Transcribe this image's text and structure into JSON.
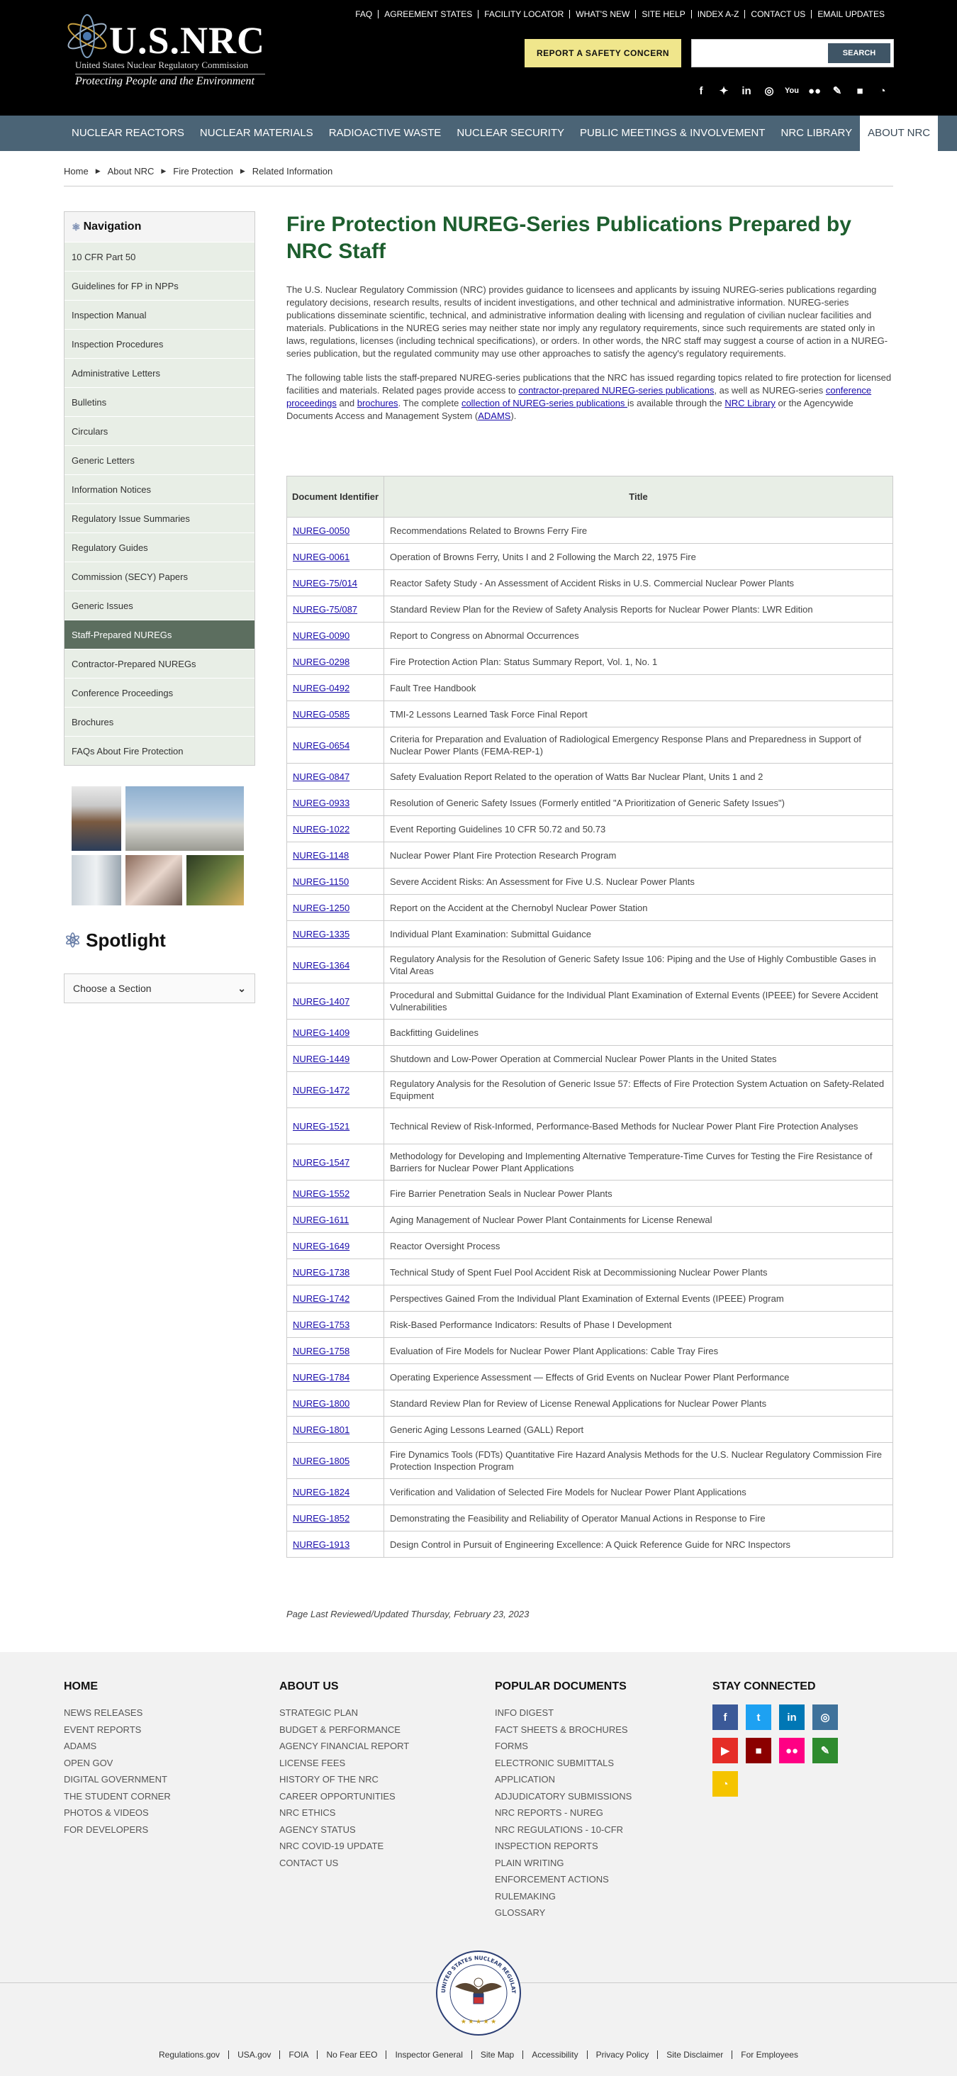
{
  "header": {
    "logo_title": "U.S.NRC",
    "logo_subtitle": "United States Nuclear Regulatory Commission",
    "logo_tagline": "Protecting People and the Environment",
    "top_links": [
      "FAQ",
      "AGREEMENT STATES",
      "FACILITY LOCATOR",
      "WHAT'S NEW",
      "SITE HELP",
      "INDEX A-Z",
      "CONTACT US",
      "EMAIL UPDATES"
    ],
    "report_button": "REPORT A SAFETY CONCERN",
    "search_button": "SEARCH",
    "search_value": "",
    "social_icons": [
      "facebook-icon",
      "twitter-icon",
      "linkedin-icon",
      "instagram-icon",
      "youtube-icon",
      "flickr-icon",
      "blog-icon",
      "chat-icon",
      "rss-icon"
    ]
  },
  "nav": [
    "NUCLEAR REACTORS",
    "NUCLEAR MATERIALS",
    "RADIOACTIVE WASTE",
    "NUCLEAR SECURITY",
    "PUBLIC MEETINGS & INVOLVEMENT",
    "NRC LIBRARY",
    "ABOUT NRC"
  ],
  "breadcrumb": [
    "Home",
    "About NRC",
    "Fire Protection",
    "Related Information"
  ],
  "sidenav": {
    "title": "Navigation",
    "items": [
      "10 CFR Part 50",
      "Guidelines for FP in NPPs",
      "Inspection Manual",
      "Inspection Procedures",
      "Administrative Letters",
      "Bulletins",
      "Circulars",
      "Generic Letters",
      "Information Notices",
      "Regulatory Issue Summaries",
      "Regulatory Guides",
      "Commission (SECY) Papers",
      "Generic Issues",
      "Staff-Prepared NUREGs",
      "Contractor-Prepared NUREGs",
      "Conference Proceedings",
      "Brochures",
      "FAQs About Fire Protection"
    ],
    "active": "Staff-Prepared NUREGs"
  },
  "spotlight": {
    "title": "Spotlight",
    "select": "Choose a Section"
  },
  "main": {
    "title": "Fire Protection NUREG-Series Publications Prepared by NRC Staff",
    "intro": "The U.S. Nuclear Regulatory Commission (NRC) provides guidance to licensees and applicants by issuing NUREG-series publications regarding regulatory decisions, research results, results of incident investigations, and other technical and administrative information. NUREG-series publications disseminate scientific, technical, and administrative information dealing with licensing and regulation of civilian nuclear facilities and materials. Publications in the NUREG series may neither state nor imply any regulatory requirements, since such requirements are stated only in laws, regulations, licenses (including technical specifications), or orders. In other words, the NRC staff may suggest a course of action in a NUREG-series publication, but the regulated community may use other approaches to satisfy the agency's regulatory requirements.",
    "p2_a": "The following table lists the staff-prepared NUREG-series publications that the NRC has issued regarding topics related to fire protection for licensed facilities and materials. Related pages provide access to ",
    "p2_link1": "contractor-prepared NUREG-series publications",
    "p2_b": ", as well as NUREG-series ",
    "p2_link2": "conference proceedings",
    "p2_c": " and ",
    "p2_link3": "brochures",
    "p2_d": ". The complete ",
    "p2_link4": "collection of NUREG-series publications ",
    "p2_e": "is available through the ",
    "p2_link5": "NRC Library",
    "p2_f": " or the Agencywide Documents Access and Management System (",
    "p2_link6": "ADAMS",
    "p2_g": ").",
    "table_headers": [
      "Document Identifier",
      "Title"
    ],
    "rows": [
      {
        "id": "NUREG-0050",
        "title": "Recommendations Related to Browns Ferry Fire"
      },
      {
        "id": "NUREG-0061",
        "title": "Operation of Browns Ferry, Units I and 2 Following the March 22, 1975 Fire"
      },
      {
        "id": "NUREG-75/014",
        "title": "Reactor Safety Study - An Assessment of Accident Risks in U.S. Commercial Nuclear Power Plants"
      },
      {
        "id": "NUREG-75/087",
        "title": "Standard Review Plan for the Review of Safety Analysis Reports for Nuclear Power Plants: LWR Edition"
      },
      {
        "id": "NUREG-0090",
        "title": "Report to Congress on Abnormal Occurrences"
      },
      {
        "id": "NUREG-0298",
        "title": "Fire Protection Action Plan: Status Summary Report, Vol. 1, No. 1"
      },
      {
        "id": "NUREG-0492",
        "title": "Fault Tree Handbook"
      },
      {
        "id": "NUREG-0585",
        "title": "TMI-2 Lessons Learned Task Force Final Report"
      },
      {
        "id": "NUREG-0654",
        "title": "Criteria for Preparation and Evaluation of Radiological Emergency Response Plans and Preparedness in Support of Nuclear Power Plants (FEMA-REP-1)"
      },
      {
        "id": "NUREG-0847",
        "title": "Safety Evaluation Report Related to the operation of Watts Bar Nuclear Plant, Units 1 and 2"
      },
      {
        "id": "NUREG-0933",
        "title": "Resolution of Generic Safety Issues (Formerly entitled \"A Prioritization of Generic Safety Issues\")"
      },
      {
        "id": "NUREG-1022",
        "title": "Event Reporting Guidelines 10 CFR 50.72 and 50.73"
      },
      {
        "id": "NUREG-1148",
        "title": "Nuclear Power Plant Fire Protection Research Program"
      },
      {
        "id": "NUREG-1150",
        "title": "Severe Accident Risks: An Assessment for Five U.S. Nuclear Power Plants"
      },
      {
        "id": "NUREG-1250",
        "title": "Report on the Accident at the Chernobyl Nuclear Power Station"
      },
      {
        "id": "NUREG-1335",
        "title": "Individual Plant Examination: Submittal Guidance"
      },
      {
        "id": "NUREG-1364",
        "title": "Regulatory Analysis for the Resolution of Generic Safety Issue 106: Piping and the Use of Highly Combustible Gases in Vital Areas"
      },
      {
        "id": "NUREG-1407",
        "title": "Procedural and Submittal Guidance for the Individual Plant Examination of External Events (IPEEE) for Severe Accident Vulnerabilities"
      },
      {
        "id": "NUREG-1409",
        "title": "Backfitting Guidelines"
      },
      {
        "id": "NUREG-1449",
        "title": "Shutdown and Low-Power Operation at Commercial Nuclear Power Plants in the United States"
      },
      {
        "id": "NUREG-1472",
        "title": "Regulatory Analysis for the Resolution of Generic Issue 57: Effects of Fire Protection System Actuation on Safety-Related Equipment"
      },
      {
        "id": "NUREG-1521",
        "title": "Technical Review of Risk-Informed, Performance-Based Methods for Nuclear Power Plant Fire Protection Analyses"
      },
      {
        "id": "NUREG-1547",
        "title": "Methodology for Developing and Implementing Alternative Temperature-Time Curves for Testing the Fire Resistance of Barriers for Nuclear Power Plant Applications"
      },
      {
        "id": "NUREG-1552",
        "title": "Fire Barrier Penetration Seals in Nuclear Power Plants"
      },
      {
        "id": "NUREG-1611",
        "title": "Aging Management of Nuclear Power Plant Containments for License Renewal"
      },
      {
        "id": "NUREG-1649",
        "title": "Reactor Oversight Process"
      },
      {
        "id": "NUREG-1738",
        "title": "Technical Study of Spent Fuel Pool Accident Risk at Decommissioning Nuclear Power Plants"
      },
      {
        "id": "NUREG-1742",
        "title": "Perspectives Gained From the Individual Plant Examination of External Events (IPEEE) Program"
      },
      {
        "id": "NUREG-1753",
        "title": "Risk-Based Performance Indicators: Results of Phase I Development"
      },
      {
        "id": "NUREG-1758",
        "title": "Evaluation of Fire Models for Nuclear Power Plant Applications: Cable Tray Fires"
      },
      {
        "id": "NUREG-1784",
        "title": "Operating Experience Assessment — Effects of Grid Events on Nuclear Power Plant Performance"
      },
      {
        "id": "NUREG-1800",
        "title": "Standard Review Plan for Review of License Renewal Applications for Nuclear Power Plants"
      },
      {
        "id": "NUREG-1801",
        "title": "Generic Aging Lessons Learned (GALL) Report"
      },
      {
        "id": "NUREG-1805",
        "title": "Fire Dynamics Tools (FDTs) Quantitative Fire Hazard Analysis Methods for the U.S. Nuclear Regulatory Commission Fire Protection Inspection Program"
      },
      {
        "id": "NUREG-1824",
        "title": "Verification and Validation of Selected Fire Models for Nuclear Power Plant Applications"
      },
      {
        "id": "NUREG-1852",
        "title": "Demonstrating the Feasibility and Reliability of Operator Manual Actions in Response to Fire"
      },
      {
        "id": "NUREG-1913",
        "title": "Design Control in Pursuit of Engineering Excellence: A Quick Reference Guide for NRC Inspectors"
      }
    ],
    "reviewed": "Page Last Reviewed/Updated Thursday, February 23, 2023"
  },
  "footer": {
    "columns": [
      {
        "heading": "HOME",
        "items": [
          "NEWS RELEASES",
          "EVENT REPORTS",
          "ADAMS",
          "OPEN GOV",
          "DIGITAL GOVERNMENT",
          "THE STUDENT CORNER",
          "PHOTOS & VIDEOS",
          "FOR DEVELOPERS"
        ]
      },
      {
        "heading": "ABOUT US",
        "items": [
          "STRATEGIC PLAN",
          "BUDGET & PERFORMANCE",
          "AGENCY FINANCIAL REPORT",
          "LICENSE FEES",
          "HISTORY OF THE NRC",
          "CAREER OPPORTUNITIES",
          "NRC ETHICS",
          "AGENCY STATUS",
          "NRC COVID-19 UPDATE",
          "CONTACT US"
        ]
      },
      {
        "heading": "POPULAR DOCUMENTS",
        "items": [
          "INFO DIGEST",
          "FACT SHEETS & BROCHURES",
          "FORMS",
          "ELECTRONIC SUBMITTALS",
          "APPLICATION",
          "ADJUDICATORY SUBMISSIONS",
          "NRC REPORTS - NUREG",
          "NRC REGULATIONS - 10-CFR",
          "INSPECTION REPORTS",
          "PLAIN WRITING",
          "ENFORCEMENT ACTIONS",
          "RULEMAKING",
          "GLOSSARY"
        ]
      }
    ],
    "connect_heading": "STAY CONNECTED",
    "connect_icons": [
      {
        "name": "facebook-icon",
        "glyph": "f",
        "color": "#3b5998"
      },
      {
        "name": "twitter-icon",
        "glyph": "t",
        "color": "#1da1f2"
      },
      {
        "name": "linkedin-icon",
        "glyph": "in",
        "color": "#0077b5"
      },
      {
        "name": "instagram-icon",
        "glyph": "◎",
        "color": "#3f729b"
      },
      {
        "name": "youtube-icon",
        "glyph": "▶",
        "color": "#e52d27"
      },
      {
        "name": "chat-icon",
        "glyph": "■",
        "color": "#8b0000"
      },
      {
        "name": "flickr-icon",
        "glyph": "●●",
        "color": "#ff0084"
      },
      {
        "name": "blog-icon",
        "glyph": "✎",
        "color": "#2e8b2e"
      },
      {
        "name": "rss-icon",
        "glyph": "◔",
        "color": "#f5c400"
      }
    ],
    "seal_text": "UNITED STATES NUCLEAR REGULATORY COMMISSION",
    "bottom_links": [
      "Regulations.gov",
      "USA.gov",
      "FOIA",
      "No Fear EEO",
      "Inspector General",
      "Site Map",
      "Accessibility",
      "Privacy Policy",
      "Site Disclaimer",
      "For Employees"
    ]
  }
}
